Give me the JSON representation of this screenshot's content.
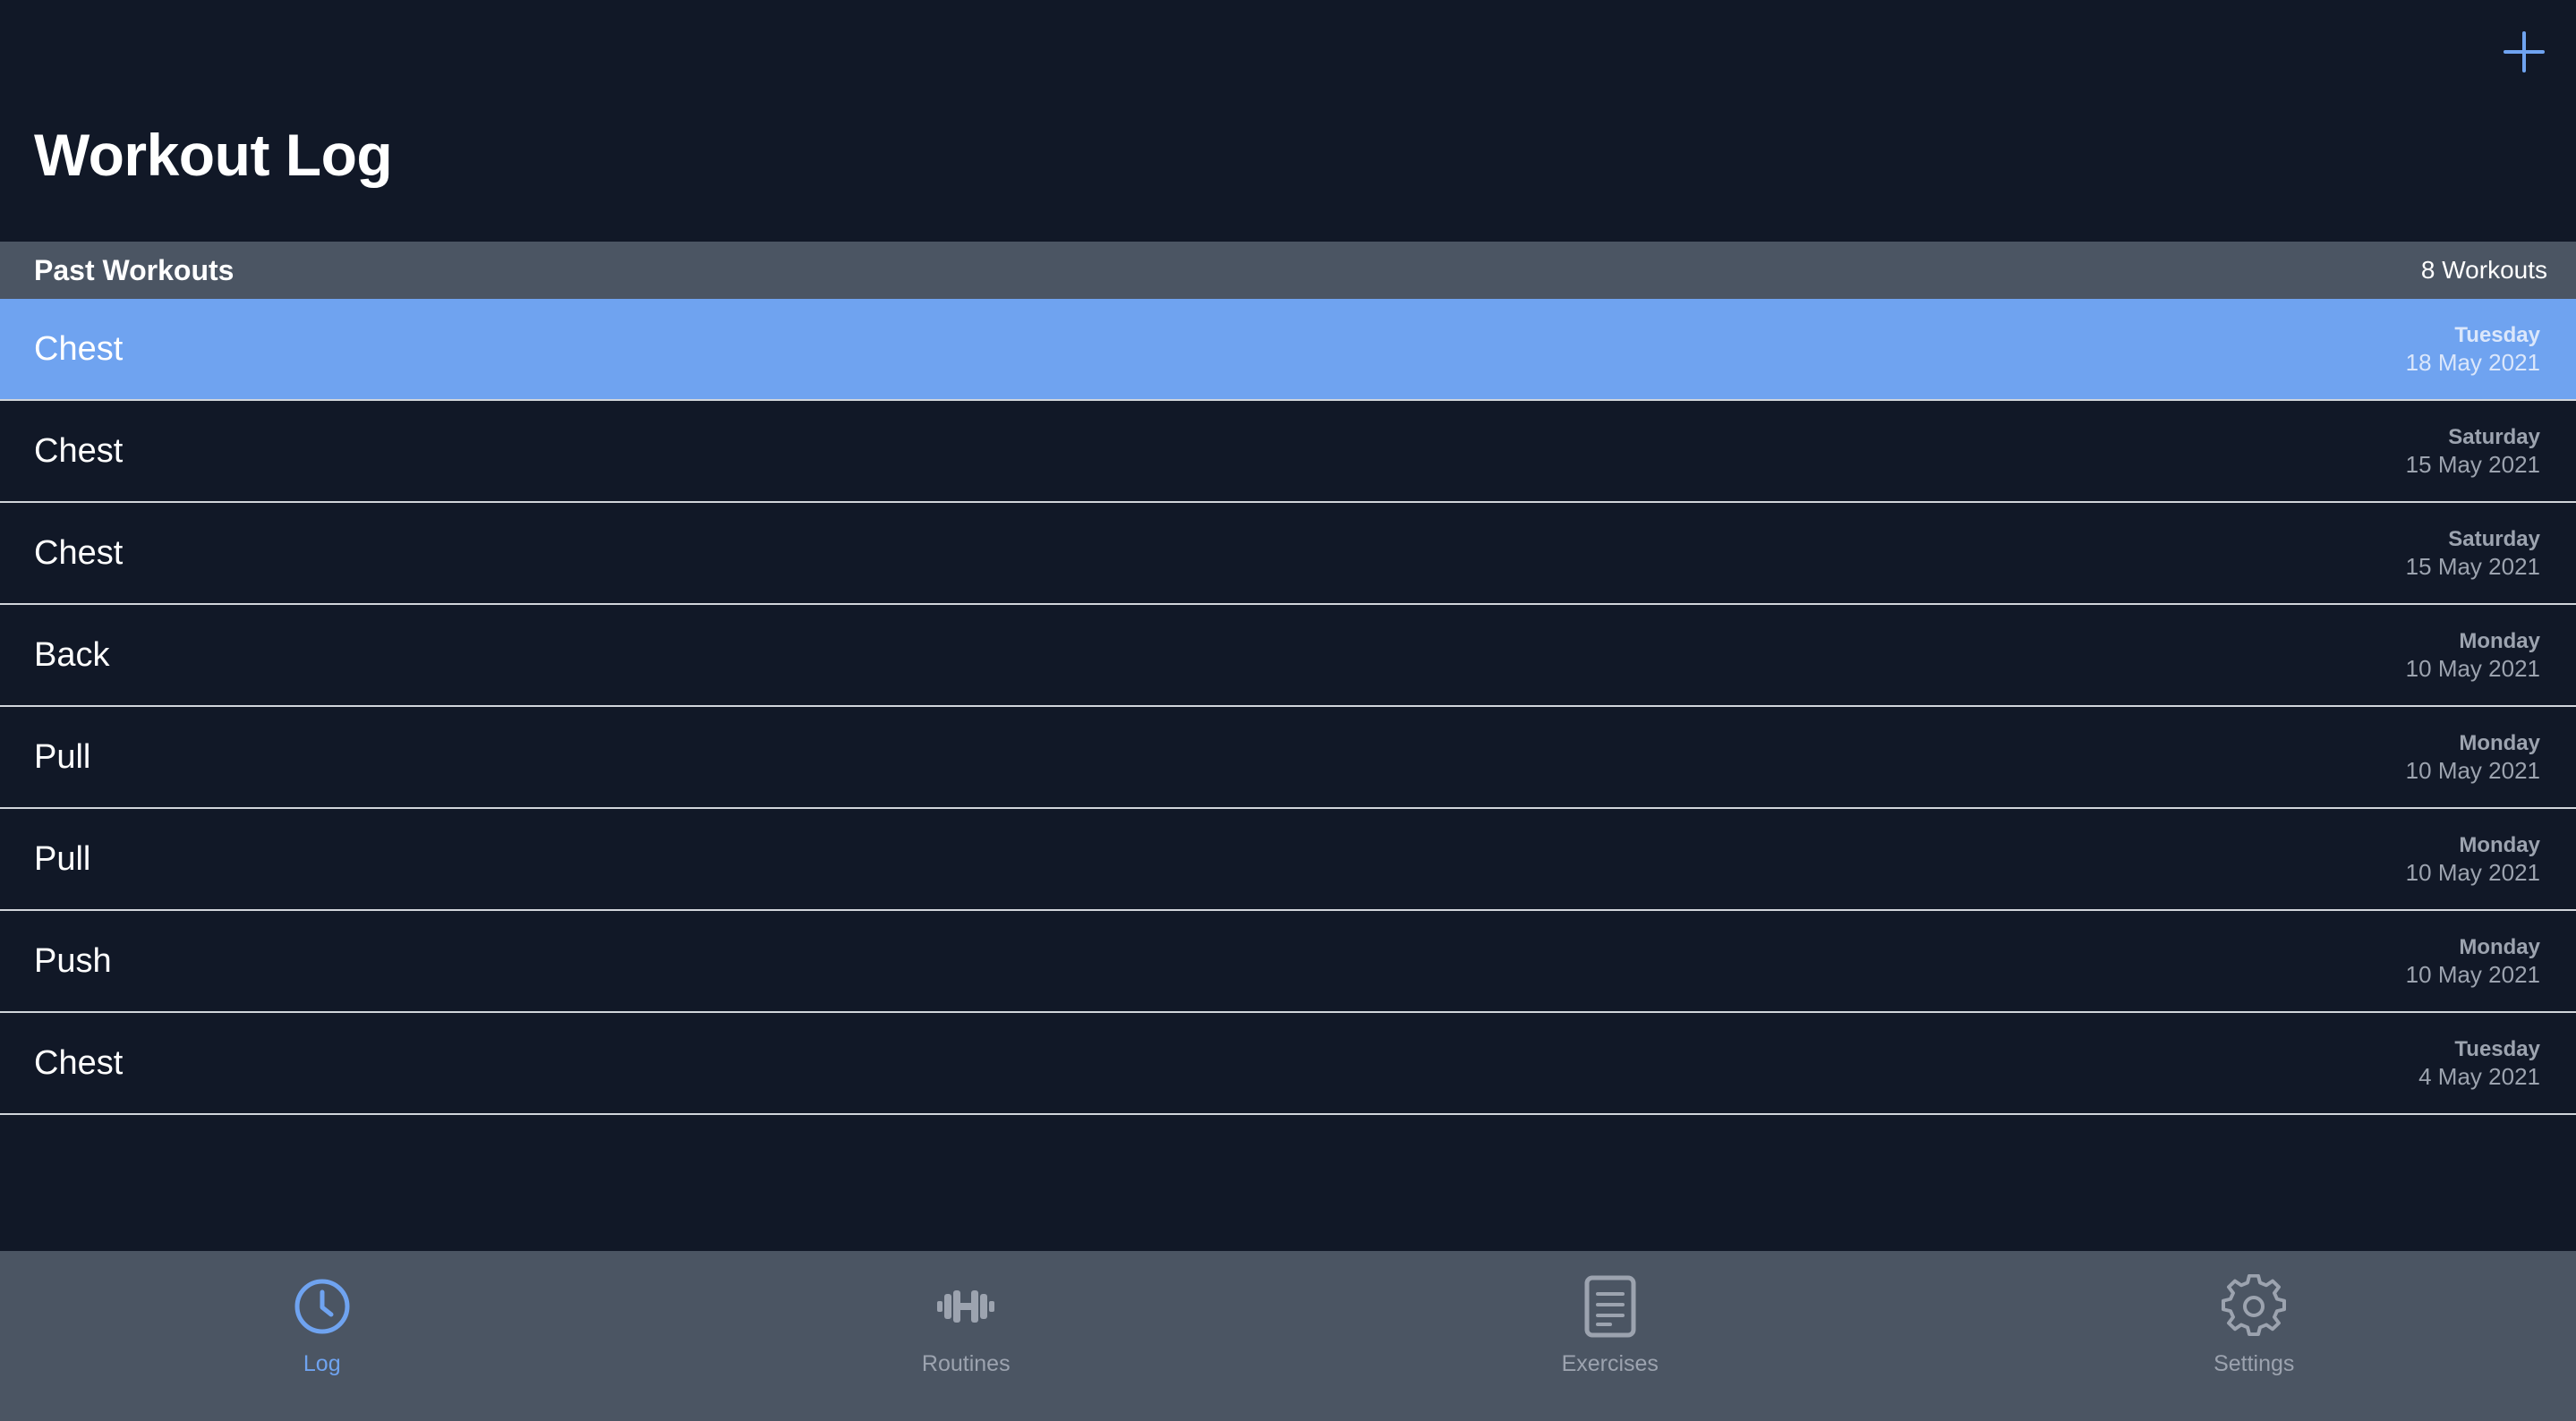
{
  "header": {
    "title": "Workout Log",
    "add_icon": "plus-icon",
    "accent_color": "#6fa3f0"
  },
  "section": {
    "title": "Past Workouts",
    "count": "8 Workouts"
  },
  "workouts": [
    {
      "title": "Chest",
      "day": "Tuesday",
      "date": "18 May 2021",
      "selected": true
    },
    {
      "title": "Chest",
      "day": "Saturday",
      "date": "15 May 2021"
    },
    {
      "title": "Chest",
      "day": "Saturday",
      "date": "15 May 2021"
    },
    {
      "title": "Back",
      "day": "Monday",
      "date": "10 May 2021"
    },
    {
      "title": "Pull",
      "day": "Monday",
      "date": "10 May 2021"
    },
    {
      "title": "Pull",
      "day": "Monday",
      "date": "10 May 2021"
    },
    {
      "title": "Push",
      "day": "Monday",
      "date": "10 May 2021"
    },
    {
      "title": "Chest",
      "day": "Tuesday",
      "date": "4 May 2021"
    }
  ],
  "tabs": [
    {
      "label": "Log",
      "icon": "clock-icon",
      "active": true
    },
    {
      "label": "Routines",
      "icon": "dumbbell-icon"
    },
    {
      "label": "Exercises",
      "icon": "document-icon"
    },
    {
      "label": "Settings",
      "icon": "gear-icon"
    }
  ],
  "colors": {
    "background": "#111827",
    "bar": "#4b5563",
    "selected_row": "#6fa3f0",
    "inactive_icon": "#9ca3af"
  }
}
